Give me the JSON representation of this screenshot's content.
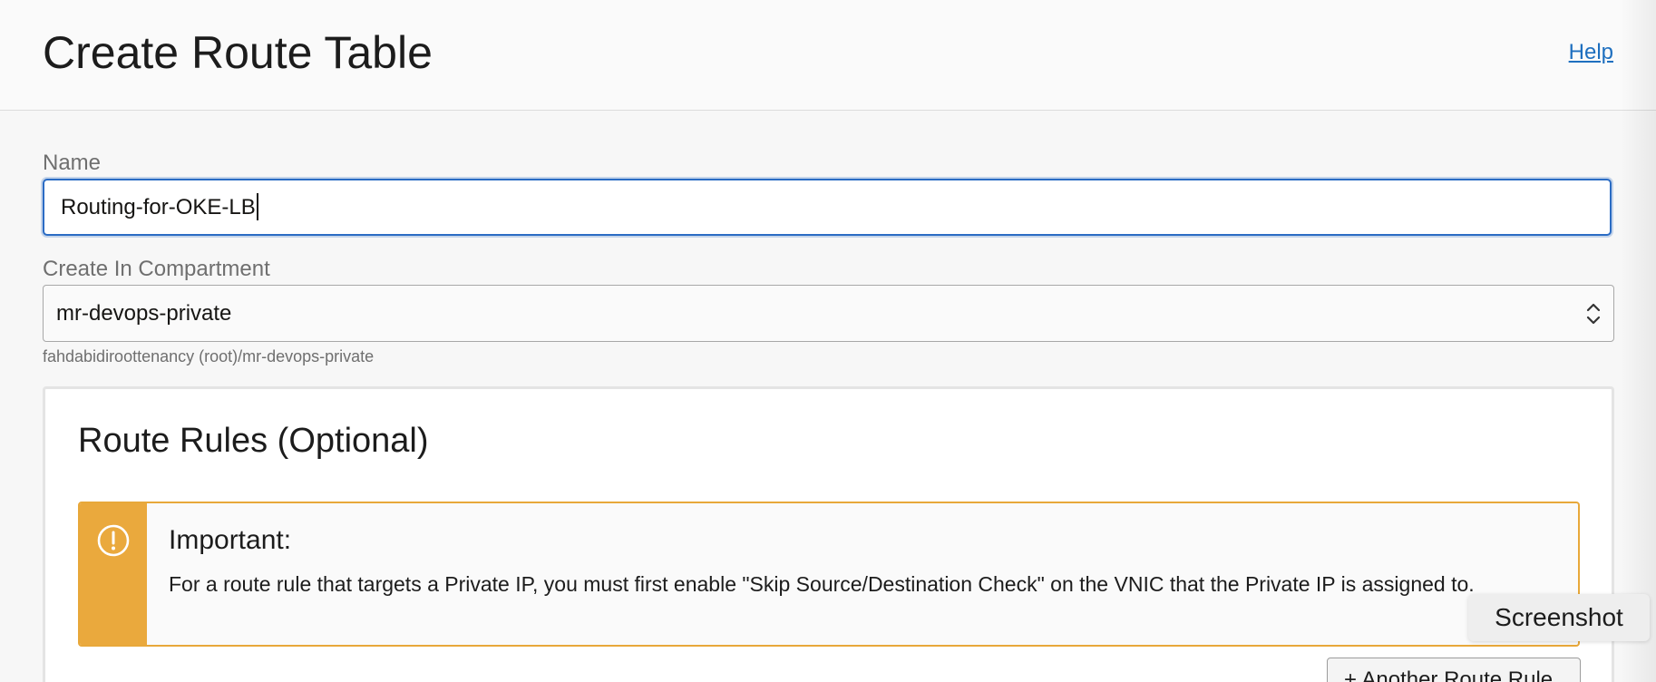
{
  "header": {
    "title": "Create Route Table",
    "help_label": "Help"
  },
  "form": {
    "name_label": "Name",
    "name_value": "Routing-for-OKE-LB",
    "compartment_label": "Create In Compartment",
    "compartment_value": "mr-devops-private",
    "compartment_path": "fahdabidiroottenancy (root)/mr-devops-private"
  },
  "route_rules": {
    "title": "Route Rules (Optional)",
    "alert": {
      "icon": "exclamation-circle-icon",
      "title": "Important:",
      "body": "For a route rule that targets a Private IP, you must first enable \"Skip Source/Destination Check\" on the VNIC that the Private IP is assigned to."
    },
    "add_rule_label": "+ Another Route Rule"
  },
  "overlay": {
    "screenshot_label": "Screenshot"
  },
  "colors": {
    "accent": "#2b6cc4",
    "link": "#1e6fbf",
    "warning": "#eaa93d"
  }
}
